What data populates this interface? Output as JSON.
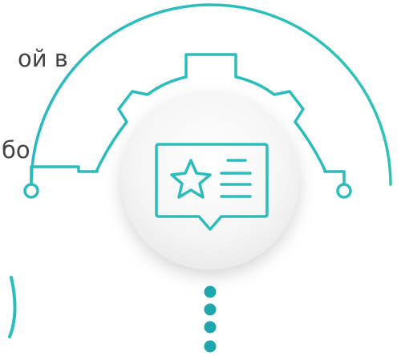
{
  "text_fragment": {
    "line1": "ой в",
    "line2": "бо"
  },
  "colors": {
    "accent": "#2cbcbc",
    "accent_dark": "#1fa7ad",
    "text": "#444444",
    "circle_fill": "#f6f6f6"
  },
  "icons": {
    "center": "review-card-icon",
    "gear": "gear-outline-icon"
  },
  "dots_count": 4
}
